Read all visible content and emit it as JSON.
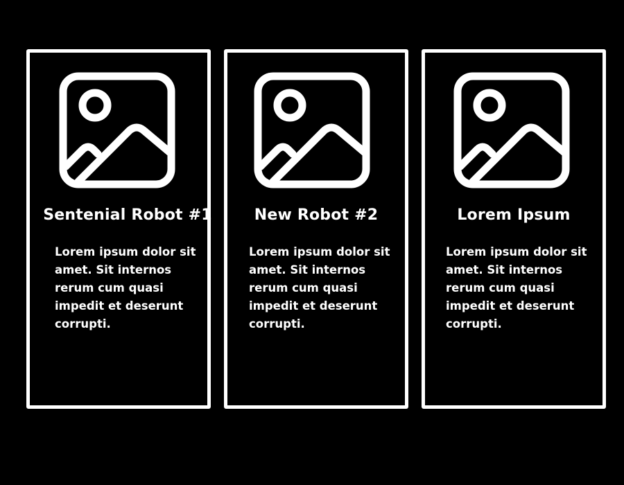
{
  "colors": {
    "background": "#000000",
    "foreground": "#ffffff"
  },
  "cards": [
    {
      "icon": "image-placeholder-icon",
      "title": "Sentenial Robot #1",
      "body": "Lorem ipsum dolor sit amet. Sit internos rerum cum quasi impedit et deserunt corrupti."
    },
    {
      "icon": "image-placeholder-icon",
      "title": "New Robot #2",
      "body": "Lorem ipsum dolor sit amet. Sit internos rerum cum quasi impedit et deserunt corrupti."
    },
    {
      "icon": "image-placeholder-icon",
      "title": "Lorem Ipsum",
      "body": "Lorem ipsum dolor sit amet. Sit internos rerum cum quasi impedit et deserunt corrupti."
    }
  ]
}
